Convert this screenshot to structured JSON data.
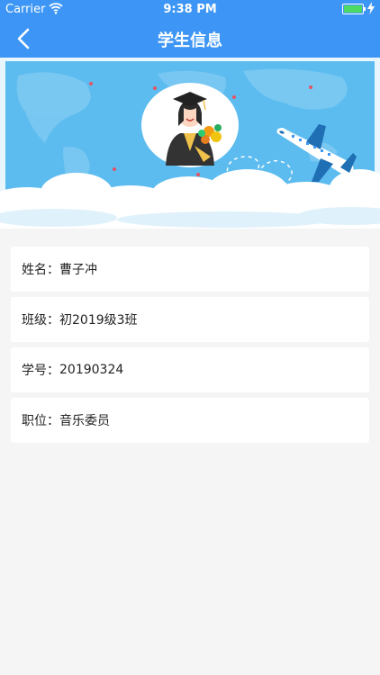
{
  "status_bar": {
    "carrier": "Carrier",
    "time": "9:38 PM"
  },
  "nav": {
    "title": "学生信息"
  },
  "fields": [
    {
      "label": "姓名：",
      "value": "曹子冲"
    },
    {
      "label": "班级：",
      "value": "初2019级3班"
    },
    {
      "label": "学号：",
      "value": "20190324"
    },
    {
      "label": "职位：",
      "value": "音乐委员"
    }
  ],
  "icons": {
    "back": "chevron-left-icon",
    "wifi": "wifi-icon",
    "battery": "battery-icon",
    "charging": "bolt-icon",
    "avatar": "graduate-avatar-icon",
    "airplane": "airplane-icon"
  },
  "colors": {
    "nav": "#3d96f5",
    "banner_sky": "#5dbcef",
    "battery": "#4cd964",
    "background": "#f5f5f5"
  }
}
